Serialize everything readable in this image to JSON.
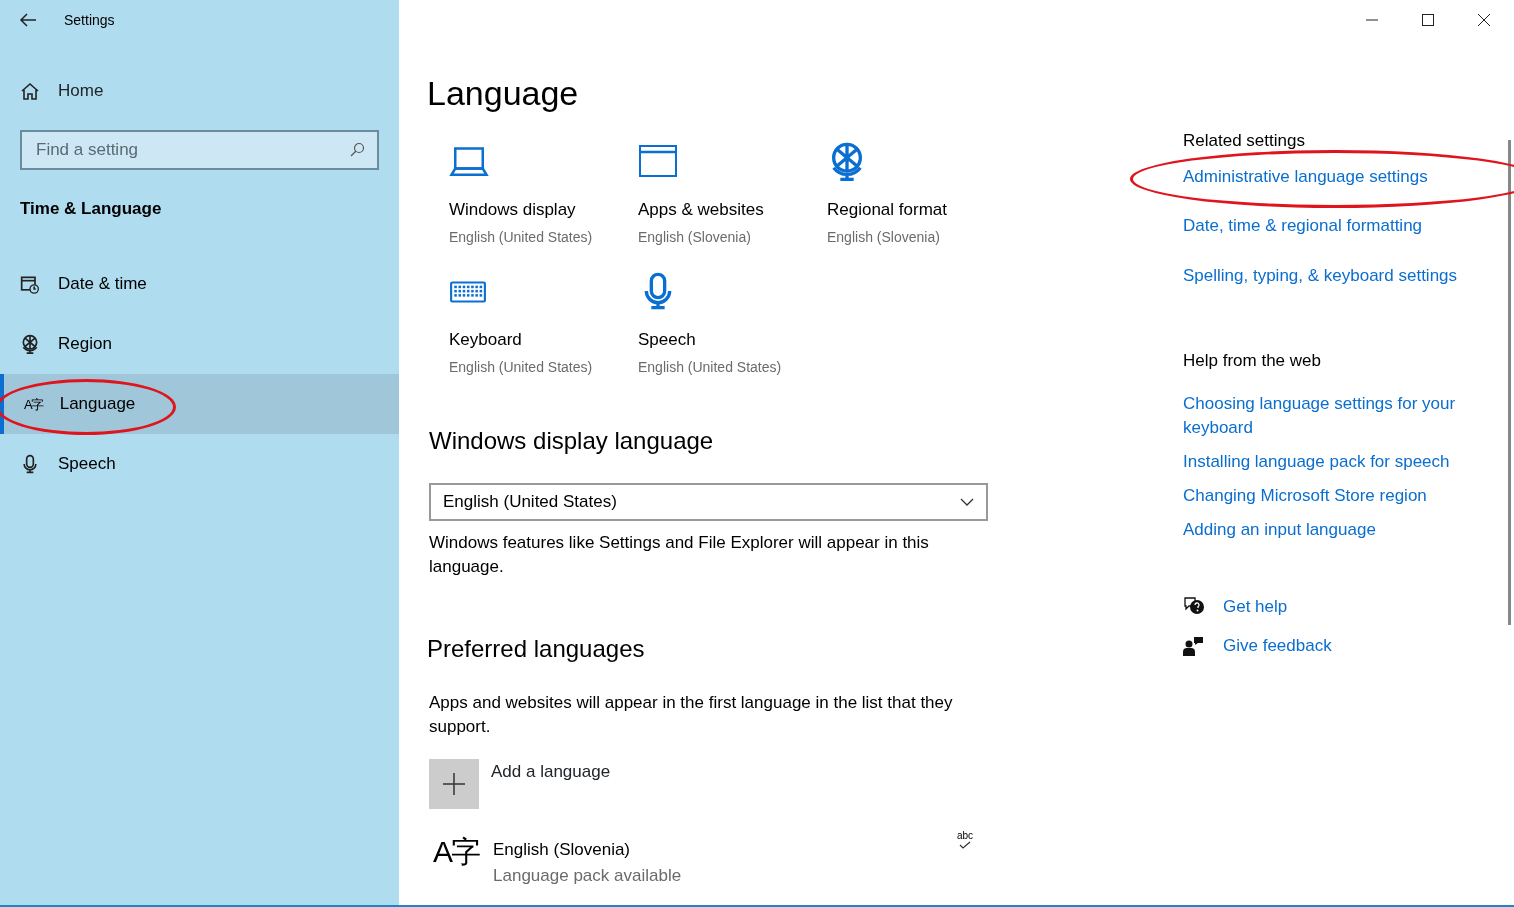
{
  "window": {
    "title": "Settings"
  },
  "sidebar": {
    "home": "Home",
    "search": {
      "placeholder": "Find a setting"
    },
    "section": "Time & Language",
    "items": [
      {
        "label": "Date & time",
        "kind": "calendar",
        "selected": false,
        "circled": false
      },
      {
        "label": "Region",
        "kind": "globe",
        "selected": false,
        "circled": false
      },
      {
        "label": "Language",
        "kind": "language",
        "glyph": "A字",
        "selected": true,
        "circled": true
      },
      {
        "label": "Speech",
        "kind": "microphone",
        "selected": false,
        "circled": false
      }
    ]
  },
  "page": {
    "title": "Language",
    "tiles": [
      {
        "title": "Windows display",
        "subtitle": "English (United States)",
        "kind": "laptop"
      },
      {
        "title": "Apps & websites",
        "subtitle": "English (Slovenia)",
        "kind": "window"
      },
      {
        "title": "Regional format",
        "subtitle": "English (Slovenia)",
        "kind": "globe"
      },
      {
        "title": "Keyboard",
        "subtitle": "English (United States)",
        "kind": "keyboard"
      },
      {
        "title": "Speech",
        "subtitle": "English (United States)",
        "kind": "microphone"
      }
    ],
    "display_language": {
      "heading": "Windows display language",
      "value": "English (United States)",
      "description": "Windows features like Settings and File Explorer will appear in this language."
    },
    "preferred": {
      "heading": "Preferred languages",
      "description": "Apps and websites will appear in the first language in the list that they support.",
      "add_label": "Add a language",
      "languages": [
        {
          "glyph": "A字",
          "name": "English (Slovenia)",
          "status": "Language pack available",
          "badge": "abc"
        }
      ]
    }
  },
  "related": {
    "heading": "Related settings",
    "links": [
      {
        "label": "Administrative language settings",
        "circled": true
      },
      {
        "label": "Date, time & regional formatting",
        "circled": false
      },
      {
        "label": "Spelling, typing, & keyboard settings",
        "circled": false
      }
    ]
  },
  "help": {
    "heading": "Help from the web",
    "links": [
      {
        "label": "Choosing language settings for your keyboard"
      },
      {
        "label": "Installing language pack for speech"
      },
      {
        "label": "Changing Microsoft Store region"
      },
      {
        "label": "Adding an input language"
      }
    ]
  },
  "support": [
    {
      "label": "Get help",
      "kind": "help"
    },
    {
      "label": "Give feedback",
      "kind": "feedback"
    }
  ]
}
